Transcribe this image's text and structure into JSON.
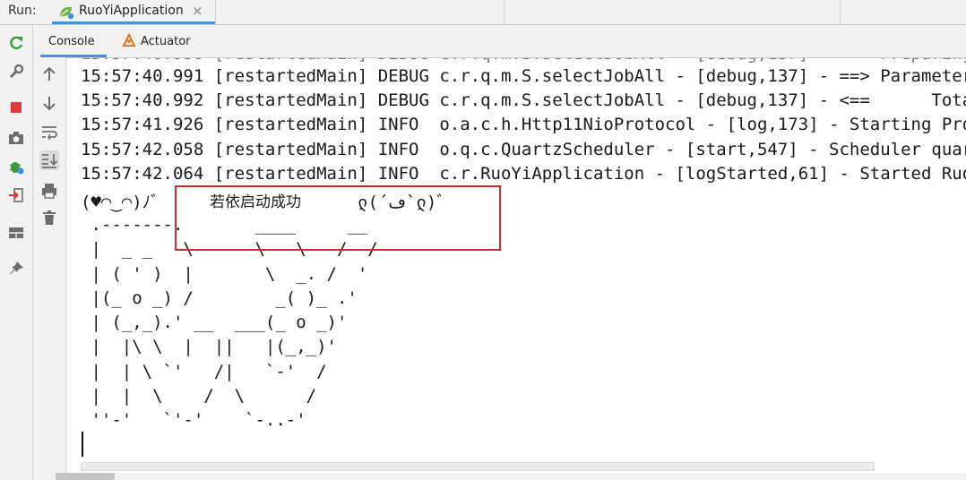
{
  "run_bar": {
    "label": "Run:",
    "tab_title": "RuoYiApplication",
    "close_glyph": "×"
  },
  "tool_window_tabs": [
    "Console",
    "Actuator"
  ],
  "left_toolbar": [
    "rerun-icon",
    "wrench-icon",
    "stop-icon",
    "camera-icon",
    "debug-bug-icon",
    "exit-icon",
    "layout-icon",
    "pin-icon"
  ],
  "console_toolbar": [
    "up-arrow-icon",
    "down-arrow-icon",
    "soft-wrap-icon",
    "scroll-to-end-icon",
    "print-icon",
    "trash-icon"
  ],
  "console": {
    "lines": [
      "15:57:40.991 [restartedMain] DEBUG c.r.q.m.S.selectJobAll - [debug,137] - ==> Parameters:",
      "15:57:40.992 [restartedMain] DEBUG c.r.q.m.S.selectJobAll - [debug,137] - <==      Total:",
      "15:57:41.926 [restartedMain] INFO  o.a.c.h.Http11NioProtocol - [log,173] - Starting ProtocolHandler",
      "15:57:42.058 [restartedMain] INFO  o.q.c.QuartzScheduler - [start,547] - Scheduler quartzScheduler",
      "15:57:42.064 [restartedMain] INFO  c.r.RuoYiApplication - [logStarted,61] - Started RuoYiApplication"
    ],
    "banner_prefix": "(♥◠‿◠)ﾉﾞ",
    "success_message": "若依启动成功",
    "banner_suffix": "ლ(´ڡ`ლ)ﾞ",
    "ascii_art": " .-------.       ____     __\n |  _ _   \\      \\   \\   /  /\n | ( ' )  |       \\  _. /  '\n |(_ o _) /        _( )_ .'\n | (_,_).' __  ___(_ o _)'\n |  |\\ \\  |  ||   |(_,_)'\n |  | \\ `'   /|   `-'  /\n |  |  \\    /  \\      /\n ''-'   `'-'    `-..-'"
  },
  "colors": {
    "accent_tab_underline": "#4a8fd8",
    "highlight_box": "#d42a2a",
    "rerun_icon": "#3c9a3c",
    "stop_icon": "#db3b3b"
  }
}
